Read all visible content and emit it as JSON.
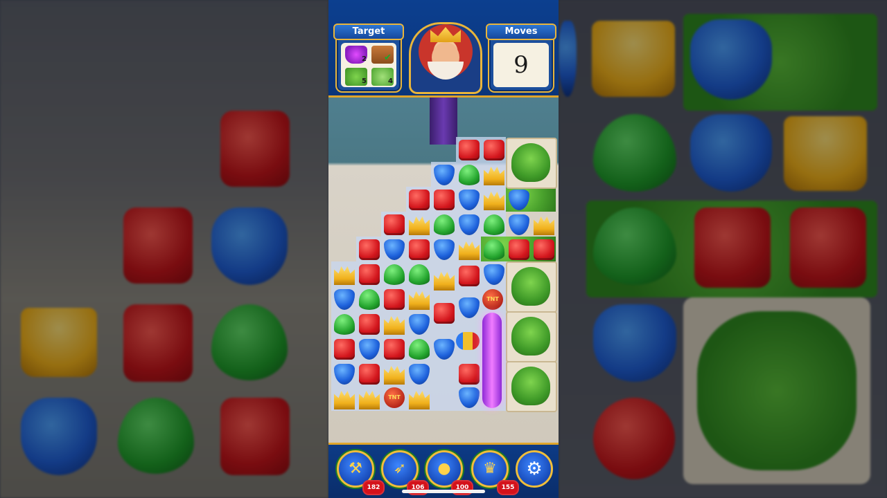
{
  "header": {
    "target_label": "Target",
    "moves_label": "Moves",
    "moves_value": "9",
    "targets": [
      {
        "icon": "magnet-icon",
        "count": "2"
      },
      {
        "icon": "crate-icon",
        "count": "",
        "done": true
      },
      {
        "icon": "hedge-icon",
        "count": "5"
      },
      {
        "icon": "clover-hedge-icon",
        "count": "4"
      }
    ]
  },
  "boosters": [
    {
      "icon": "hammer-icon",
      "count": "182"
    },
    {
      "icon": "arrow-icon",
      "count": "106"
    },
    {
      "icon": "cannon-icon",
      "count": "100"
    },
    {
      "icon": "jester-hat-icon",
      "count": "155"
    }
  ],
  "tnt_label": "TNT",
  "colors": {
    "header": "#0c3f8f",
    "gold": "#e9b53a",
    "red": "#d3161d",
    "blue": "#1e62dc",
    "green": "#25a62f",
    "yellow": "#f0b01c"
  }
}
